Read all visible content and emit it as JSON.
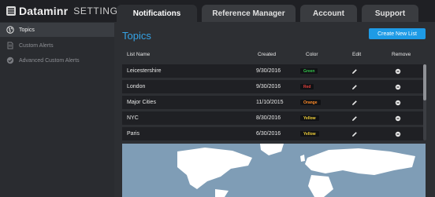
{
  "header": {
    "logo_name": "Dataminr",
    "logo_suffix": "SETTINGS",
    "tabs": [
      {
        "label": "Notifications",
        "active": true
      },
      {
        "label": "Reference Manager",
        "active": false
      },
      {
        "label": "Account",
        "active": false
      },
      {
        "label": "Support",
        "active": false
      }
    ]
  },
  "sidebar": {
    "items": [
      {
        "label": "Topics",
        "icon": "globe-icon",
        "active": true
      },
      {
        "label": "Custom Alerts",
        "icon": "document-icon",
        "active": false
      },
      {
        "label": "Advanced Custom Alerts",
        "icon": "checkmark-circle-icon",
        "active": false
      }
    ]
  },
  "main": {
    "title": "Topics",
    "create_button": "Create New List",
    "columns": {
      "list_name": "List Name",
      "created": "Created",
      "color": "Color",
      "edit": "Edit",
      "remove": "Remove"
    },
    "rows": [
      {
        "name": "Leicestershire",
        "created": "9/30/2016",
        "color_label": "Green",
        "color_hex": "#33c34a"
      },
      {
        "name": "London",
        "created": "9/30/2016",
        "color_label": "Red",
        "color_hex": "#e3413b"
      },
      {
        "name": "Major Cities",
        "created": "11/10/2015",
        "color_label": "Orange",
        "color_hex": "#ff8c2a"
      },
      {
        "name": "NYC",
        "created": "8/30/2016",
        "color_label": "Yellow",
        "color_hex": "#f2d13a"
      },
      {
        "name": "Paris",
        "created": "6/30/2016",
        "color_label": "Yellow",
        "color_hex": "#f2d13a"
      }
    ]
  },
  "colors": {
    "accent": "#1e9be6",
    "title": "#35a3e6",
    "header_bg": "#1f2024",
    "map_water": "#7f9db6",
    "map_land": "#ffffff"
  }
}
